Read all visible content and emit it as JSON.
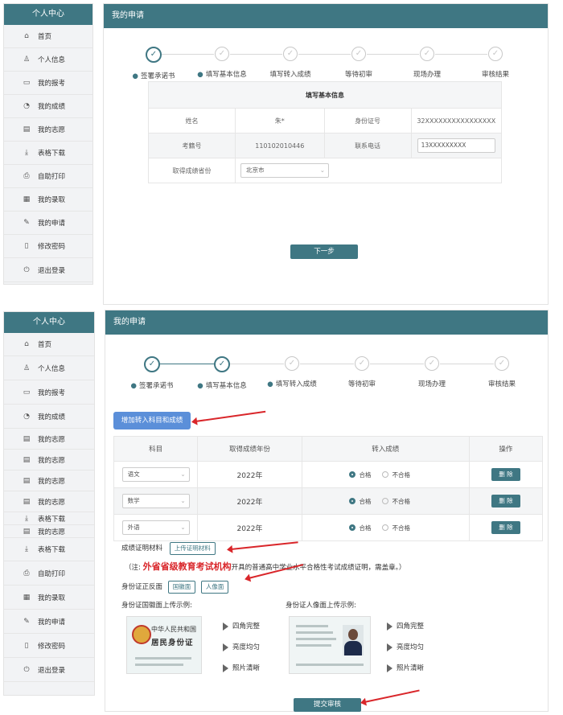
{
  "sidebar1": {
    "title": "个人中心",
    "items": [
      {
        "icon": "home-icon",
        "label": "首页"
      },
      {
        "icon": "user-icon",
        "label": "个人信息"
      },
      {
        "icon": "id-card-icon",
        "label": "我的报考"
      },
      {
        "icon": "pie-chart-icon",
        "label": "我的成绩"
      },
      {
        "icon": "document-icon",
        "label": "我的志愿"
      },
      {
        "icon": "download-icon",
        "label": "表格下载"
      },
      {
        "icon": "printer-icon",
        "label": "自助打印"
      },
      {
        "icon": "calendar-icon",
        "label": "我的录取"
      },
      {
        "icon": "edit-icon",
        "label": "我的申请"
      },
      {
        "icon": "lock-icon",
        "label": "修改密码"
      },
      {
        "icon": "logout-icon",
        "label": "退出登录"
      }
    ]
  },
  "main1": {
    "title": "我的申请",
    "steps": [
      "签署承诺书",
      "填写基本信息",
      "填写转入成绩",
      "等待初审",
      "现场办理",
      "审核结果"
    ],
    "table_title": "填写基本信息",
    "row1": {
      "name_label": "姓名",
      "name_value": "朱*",
      "id_label": "身份证号",
      "id_value": "32XXXXXXXXXXXXXXXX"
    },
    "row2": {
      "exam_label": "考籍号",
      "exam_value": "110102010446",
      "phone_label": "联系电话",
      "phone_value": "13XXXXXXXXX"
    },
    "row3": {
      "province_label": "取得成绩省份",
      "province_value": "北京市"
    },
    "next_button": "下一步"
  },
  "sidebar2": {
    "title": "个人中心",
    "items": [
      {
        "icon": "home-icon",
        "label": "首页"
      },
      {
        "icon": "user-icon",
        "label": "个人信息"
      },
      {
        "icon": "id-card-icon",
        "label": "我的报考"
      },
      {
        "icon": "pie-chart-icon",
        "label": "我的成绩"
      },
      {
        "icon": "document-icon",
        "label": "我的志愿"
      },
      {
        "icon": "document-icon",
        "label": "我的志愿"
      },
      {
        "icon": "document-icon",
        "label": "我的志愿"
      },
      {
        "icon": "document-icon",
        "label": "我的志愿"
      },
      {
        "icon": "download-icon",
        "label": "表格下载"
      },
      {
        "icon": "document-icon",
        "label": "我的志愿"
      },
      {
        "icon": "download-icon",
        "label": "表格下载"
      },
      {
        "icon": "printer-icon",
        "label": "自助打印"
      },
      {
        "icon": "calendar-icon",
        "label": "我的录取"
      },
      {
        "icon": "edit-icon",
        "label": "我的申请"
      },
      {
        "icon": "lock-icon",
        "label": "修改密码"
      },
      {
        "icon": "logout-icon",
        "label": "退出登录"
      }
    ]
  },
  "main2": {
    "title": "我的申请",
    "steps": [
      "签署承诺书",
      "填写基本信息",
      "填写转入成绩",
      "等待初审",
      "现场办理",
      "审核结果"
    ],
    "add_button": "增加转入科目和成绩",
    "columns": [
      "科目",
      "取得成绩年份",
      "转入成绩",
      "操作"
    ],
    "rows": [
      {
        "subject": "语文",
        "year": "2022年",
        "pass": "合格",
        "fail": "不合格",
        "action": "删 除"
      },
      {
        "subject": "数学",
        "year": "2022年",
        "pass": "合格",
        "fail": "不合格",
        "action": "删 除"
      },
      {
        "subject": "外语",
        "year": "2022年",
        "pass": "合格",
        "fail": "不合格",
        "action": "删 除"
      }
    ],
    "proof_label": "成绩证明材料",
    "proof_button": "上传证明材料",
    "note_prefix": "（注:",
    "note_highlight": "外省省级教育考试机构",
    "note_suffix": "开具的普通高中学业水平合格性考试成绩证明，需盖章。）",
    "id_label": "身份证正反面",
    "id_front_button": "国徽面",
    "id_back_button": "人像面",
    "example_front_title": "身份证国徽面上传示例:",
    "example_back_title": "身份证人像面上传示例:",
    "card_front_line1": "中华人民共和国",
    "card_front_line2": "居民身份证",
    "checks": [
      "四角完整",
      "亮度均匀",
      "照片清晰"
    ],
    "submit_button": "提交审核"
  },
  "colors": {
    "primary": "#3f7783",
    "blue_button": "#5b8fd9",
    "annotation_red": "#d9262a"
  }
}
